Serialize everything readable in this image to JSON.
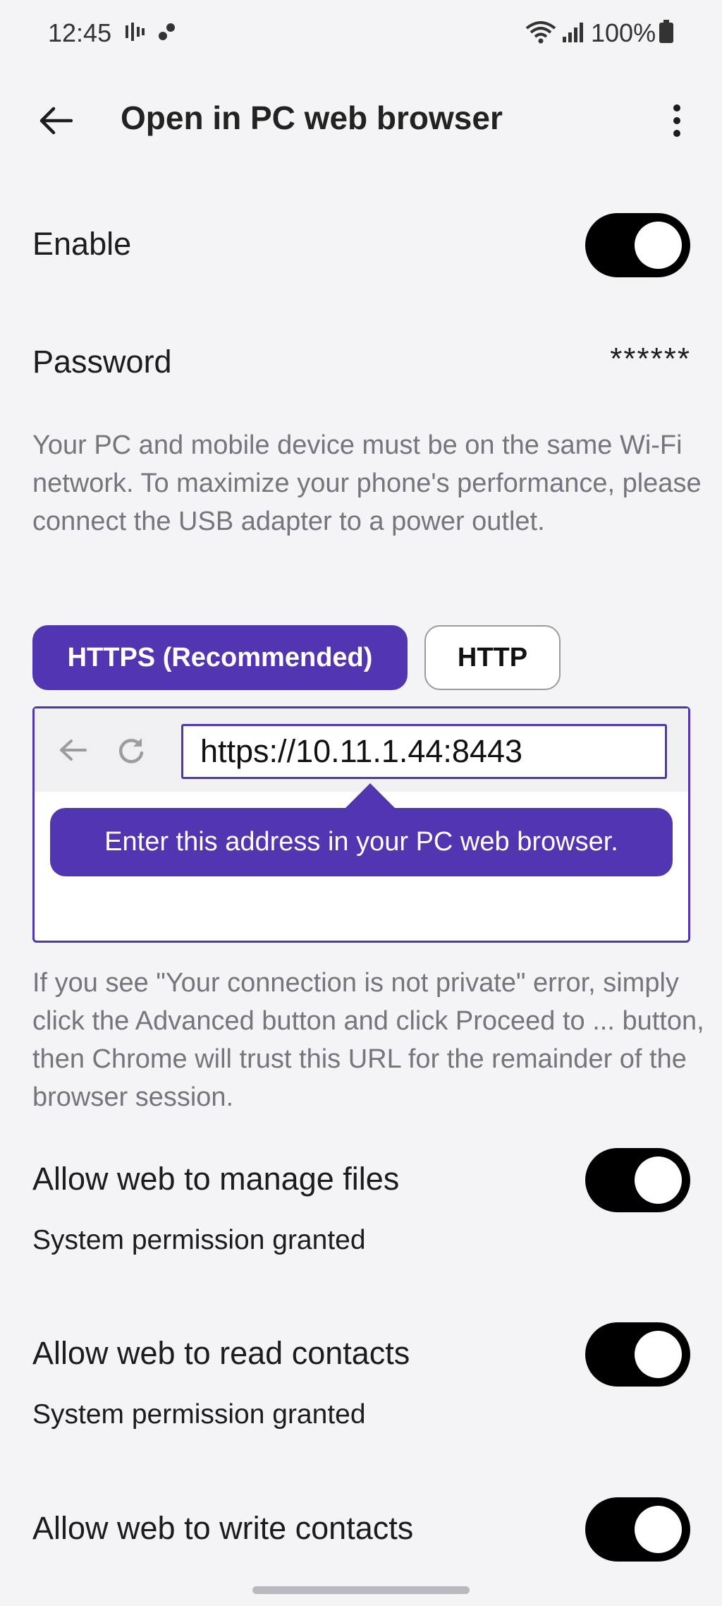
{
  "status_bar": {
    "time": "12:45",
    "battery_text": "100%"
  },
  "app_bar": {
    "title": "Open in PC web browser",
    "back_icon": "arrow-left-icon",
    "more_icon": "more-vert-icon"
  },
  "enable": {
    "label": "Enable",
    "on": true
  },
  "password": {
    "label": "Password",
    "value": "******"
  },
  "note_wifi": "Your PC and mobile device must be on the same Wi-Fi network. To maximize your phone's performance, please connect the USB adapter to a power outlet.",
  "protocols": {
    "https_label": "HTTPS (Recommended)",
    "http_label": "HTTP",
    "selected": "https"
  },
  "browser": {
    "url": "https://10.11.1.44:8443",
    "tooltip": "Enter this address in your PC web browser."
  },
  "note_private": "If you see \"Your connection is not private\" error, simply click the Advanced button and click Proceed to ... button, then Chrome will trust this URL for the remainder of the browser session.",
  "permissions": [
    {
      "label": "Allow web to manage files",
      "sub": "System permission granted",
      "on": true
    },
    {
      "label": "Allow web to read contacts",
      "sub": "System permission granted",
      "on": true
    },
    {
      "label": "Allow web to write contacts",
      "on": true
    }
  ],
  "colors": {
    "accent": "#5135b1",
    "switch_on": "#000000",
    "note_text": "#74757d"
  }
}
